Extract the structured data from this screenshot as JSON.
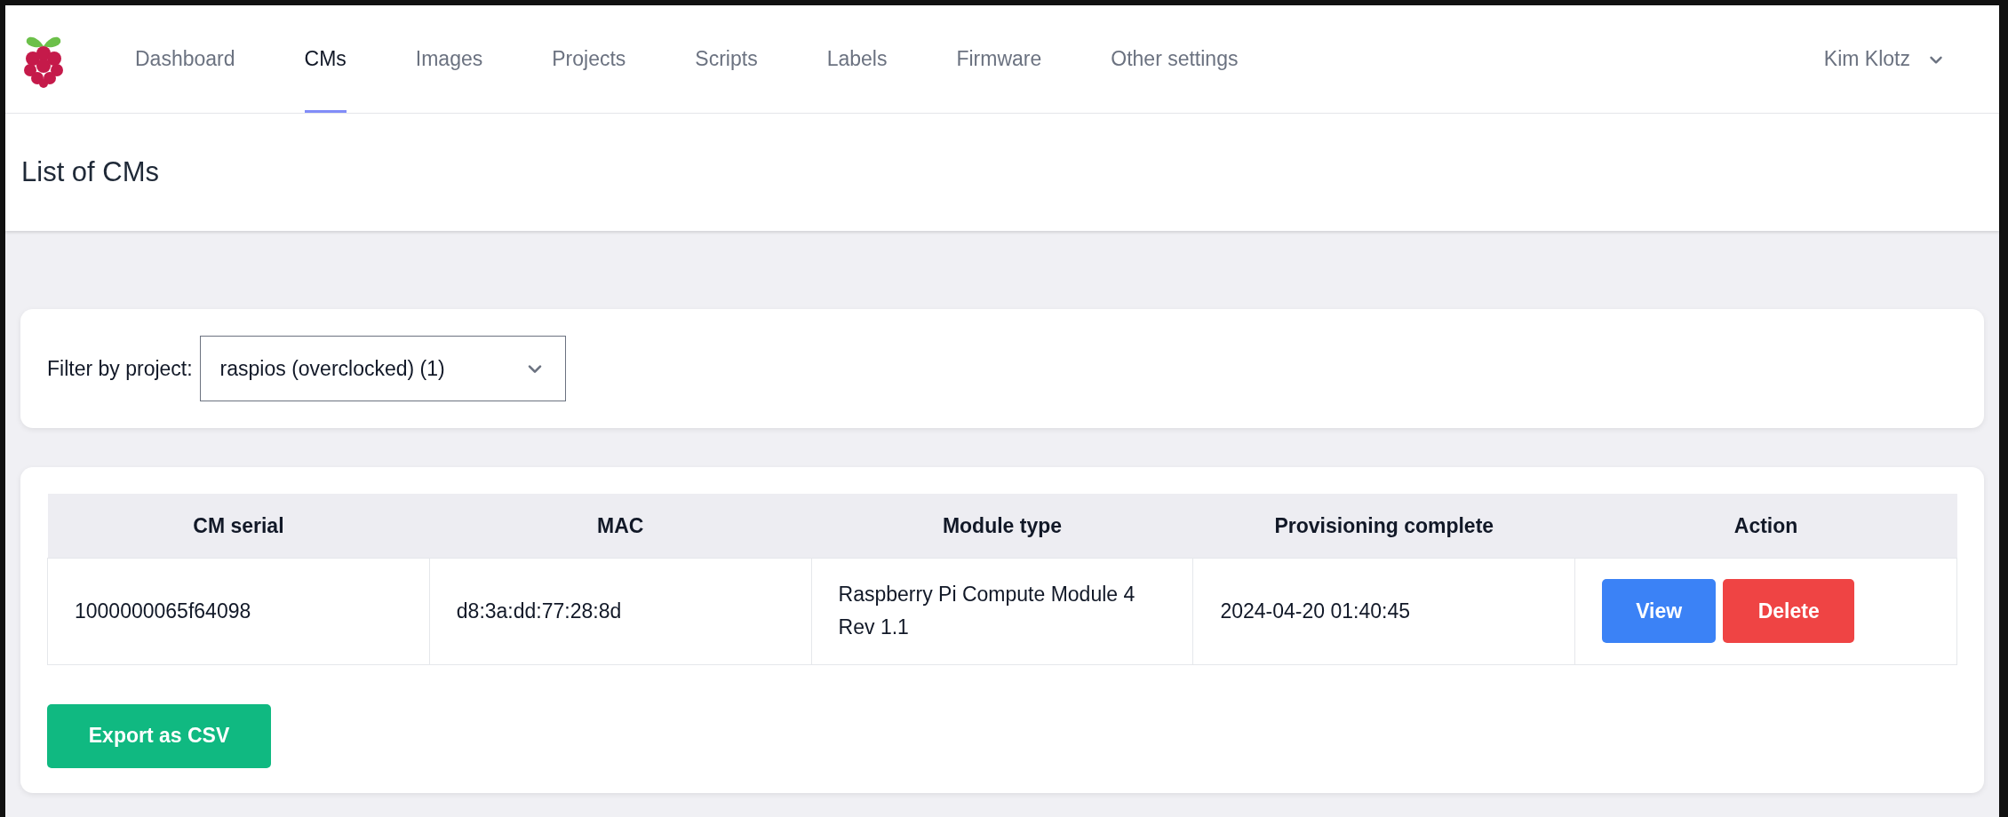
{
  "nav": {
    "items": [
      {
        "label": "Dashboard",
        "selected": false
      },
      {
        "label": "CMs",
        "selected": true
      },
      {
        "label": "Images",
        "selected": false
      },
      {
        "label": "Projects",
        "selected": false
      },
      {
        "label": "Scripts",
        "selected": false
      },
      {
        "label": "Labels",
        "selected": false
      },
      {
        "label": "Firmware",
        "selected": false
      },
      {
        "label": "Other settings",
        "selected": false
      }
    ],
    "user": "Kim Klotz"
  },
  "page_title": "List of CMs",
  "filter": {
    "label": "Filter by project:",
    "value": "raspios (overclocked) (1)"
  },
  "table": {
    "columns": [
      "CM serial",
      "MAC",
      "Module type",
      "Provisioning complete",
      "Action"
    ],
    "rows": [
      {
        "cells": [
          "1000000065f64098",
          "d8:3a:dd:77:28:8d",
          "Raspberry Pi Compute Module 4 Rev 1.1",
          "2024-04-20 01:40:45"
        ],
        "actions": [
          "View",
          "Delete"
        ]
      }
    ]
  },
  "export_button": "Export as CSV"
}
